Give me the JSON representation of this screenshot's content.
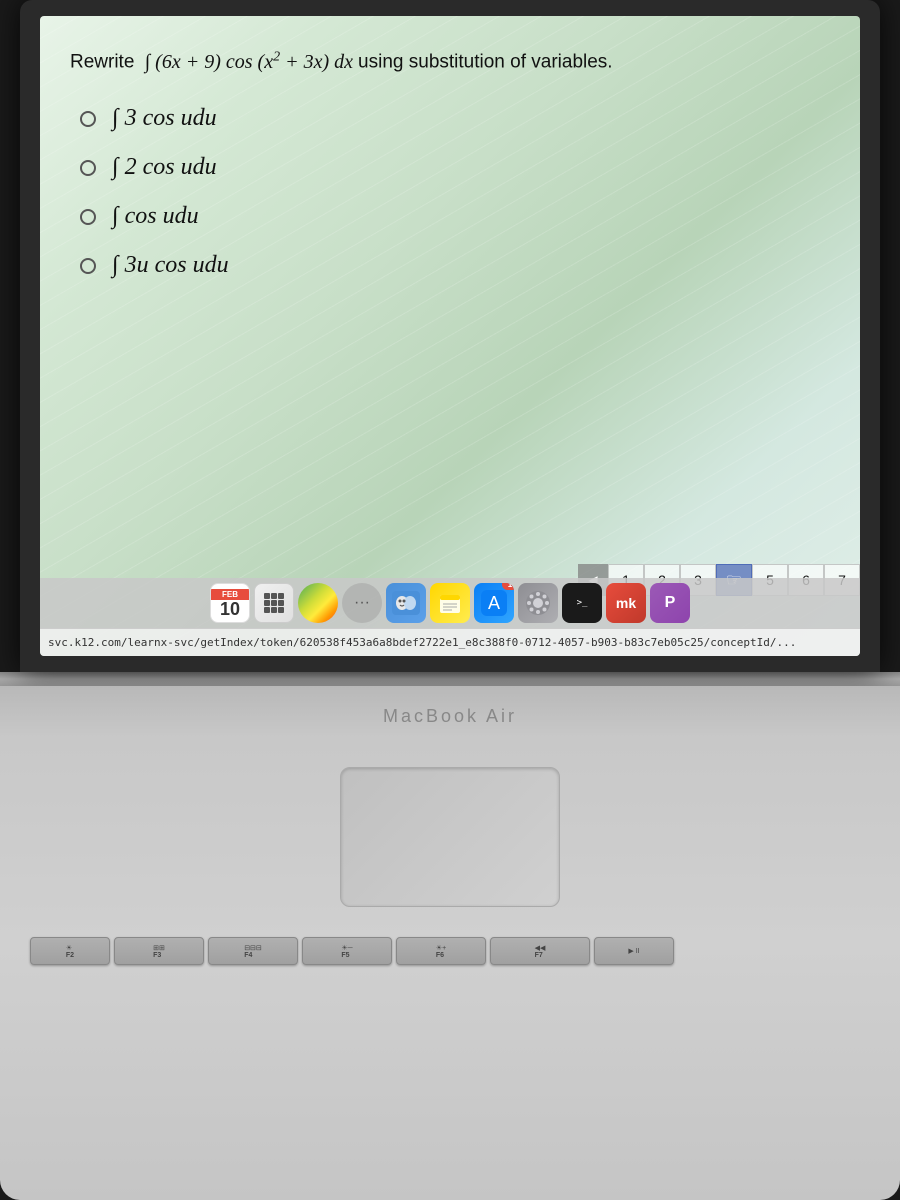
{
  "screen": {
    "question": {
      "prefix": "Rewrite",
      "integral_expression": "∫ (6x + 9) cos (x² + 3x) dx",
      "suffix": "using substitution of variables."
    },
    "options": [
      {
        "id": "a",
        "math": "∫ 3 cos u du"
      },
      {
        "id": "b",
        "math": "∫ 2 cos u du"
      },
      {
        "id": "c",
        "math": "∫ cos u du"
      },
      {
        "id": "d",
        "math": "∫ 3u cos u du"
      }
    ],
    "pagination": {
      "pages": [
        "1",
        "2",
        "3",
        "4",
        "5",
        "6",
        "7"
      ],
      "active_page": "4",
      "cursor_page": "4"
    },
    "url": "svc.k12.com/learnx-svc/getIndex/token/620538f453a6a8bdef2722e1_e8c388f0-0712-4057-b903-b83c7eb05c25/conceptId/..."
  },
  "dock": {
    "calendar_month": "FEB",
    "calendar_day": "10",
    "badge_count": "1",
    "mk_label": "mk",
    "purple_label": "P",
    "terminal_label": ">_"
  },
  "laptop": {
    "brand_label": "MacBook Air"
  },
  "keyboard": {
    "fn_keys": [
      {
        "icon": "☀",
        "label": "F2"
      },
      {
        "icon": "⊞",
        "label": "F3"
      },
      {
        "icon": "⊟",
        "label": "F4"
      },
      {
        "icon": "↑",
        "label": "F5"
      },
      {
        "icon": "↓",
        "label": "F6"
      },
      {
        "icon": "◀◀",
        "label": "F7"
      },
      {
        "icon": "▶II",
        "label": ""
      }
    ]
  }
}
